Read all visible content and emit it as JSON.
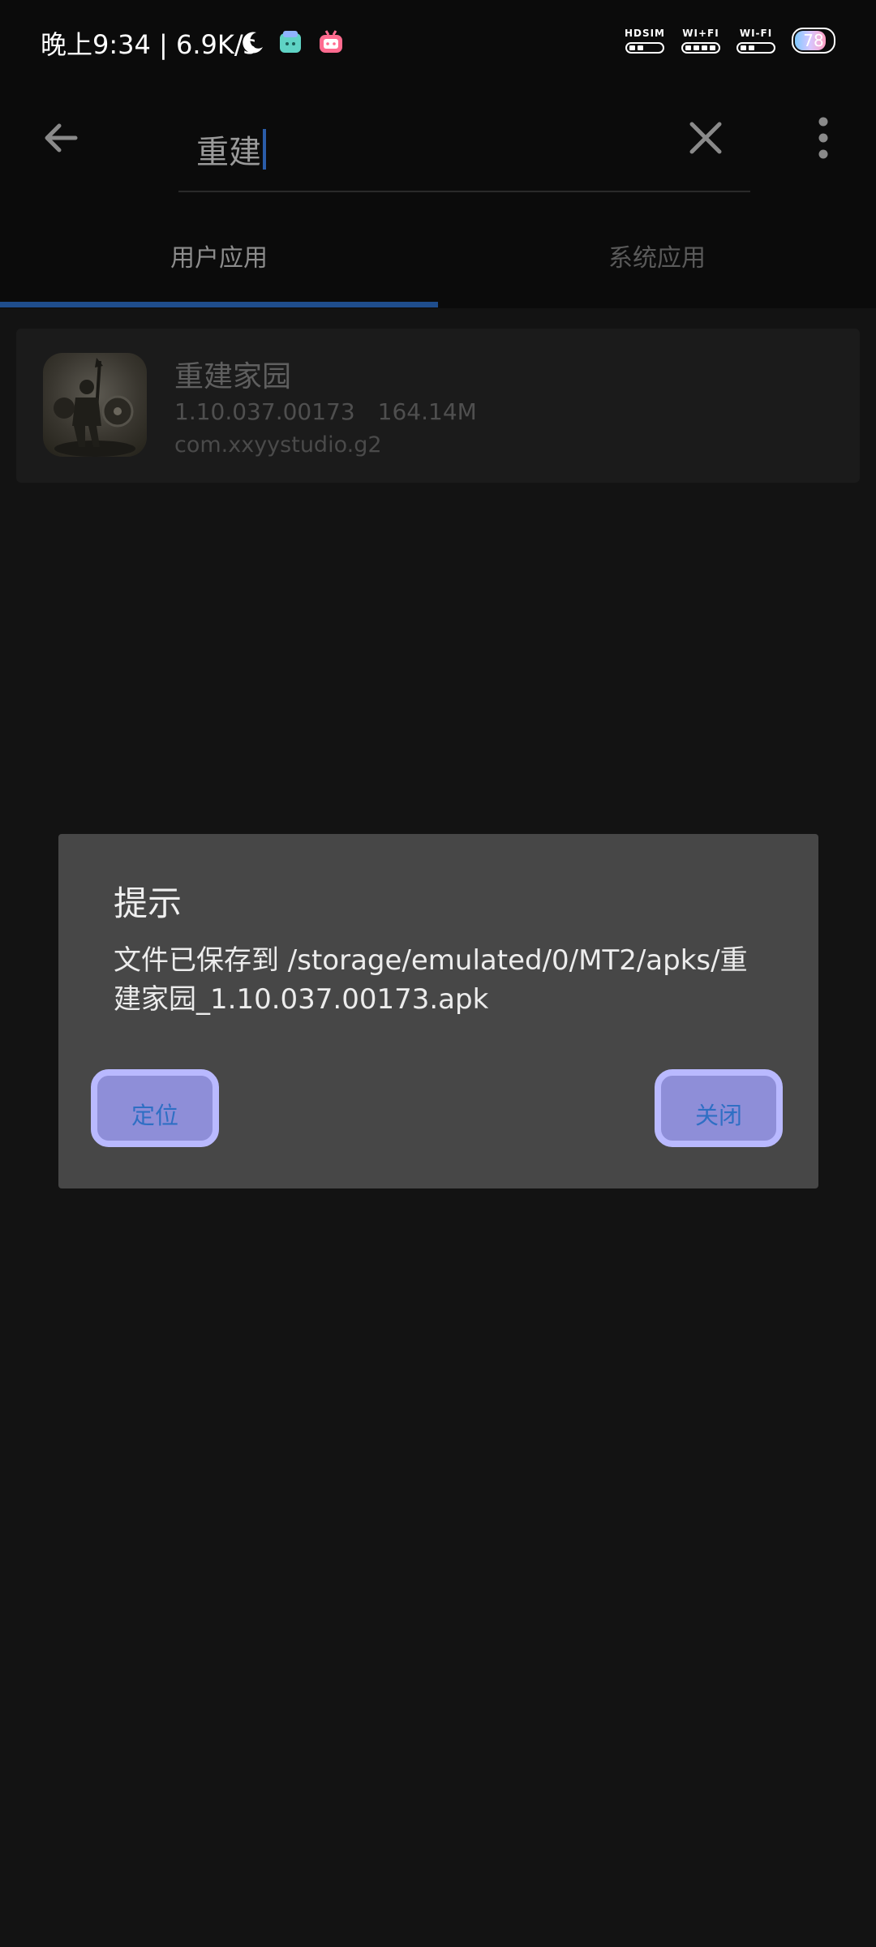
{
  "status_bar": {
    "time_speed": "晚上9:34 | 6.9K/s",
    "icons": [
      "moon-icon",
      "app-notify-icon",
      "bilibili-icon"
    ],
    "signals": [
      {
        "label": "HDSIM",
        "level": 2
      },
      {
        "label": "WI+FI",
        "level": 4
      },
      {
        "label": "WI-FI",
        "level": 2
      }
    ],
    "battery_level": "78",
    "battery_fraction": 0.78
  },
  "search": {
    "query": "重建"
  },
  "tabs": [
    {
      "label": "用户应用",
      "selected": true
    },
    {
      "label": "系统应用",
      "selected": false
    }
  ],
  "app_list": [
    {
      "name": "重建家园",
      "version": "1.10.037.00173",
      "size": "164.14M",
      "package": "com.xxyystudio.g2"
    }
  ],
  "dialog": {
    "title": "提示",
    "message": "文件已保存到 /storage/emulated/0/MT2/apks/重建家园_1.10.037.00173.apk",
    "buttons": {
      "locate": "定位",
      "close": "关闭"
    }
  },
  "colors": {
    "accent": "#1f4d8c",
    "dialog_bg": "#474747",
    "button_fill": "#8e8ed8",
    "button_border": "#b9b9ff",
    "button_text": "#2f6fc4"
  }
}
